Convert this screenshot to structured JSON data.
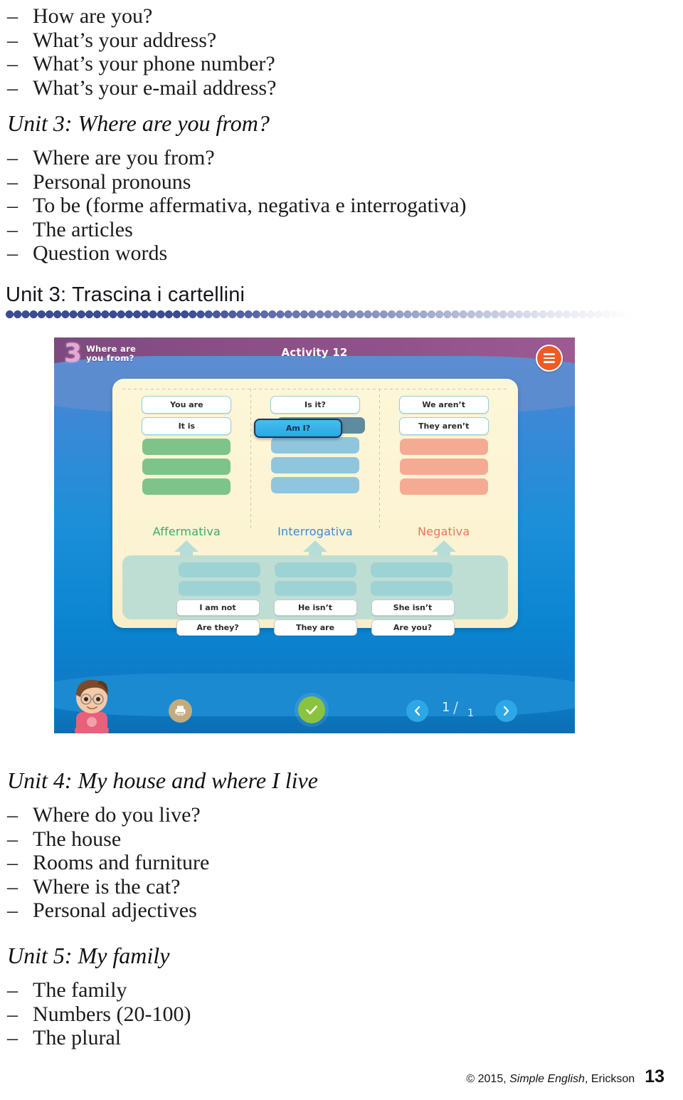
{
  "outline_top": {
    "items": [
      "How are you?",
      "What’s your address?",
      "What’s your phone number?",
      "What’s your e-mail address?"
    ]
  },
  "unit3": {
    "title": "Unit 3: Where are you from?",
    "items": [
      "Where are you from?",
      "Personal pronouns",
      "To be (forme affermativa, negativa e interrogativa)",
      "The articles",
      "Question words"
    ]
  },
  "section": {
    "heading": "Unit 3: Trascina i cartellini"
  },
  "app": {
    "unit_number": "3",
    "unit_subtitle_line1": "Where are",
    "unit_subtitle_line2": "you from?",
    "activity_title": "Activity 12",
    "menu_icon": "hamburger-menu-icon",
    "columns": [
      {
        "category": "Affermativa",
        "category_color": "#3bab6e",
        "slot_color": "#7ec48a",
        "tiles": [
          "You are",
          "It is"
        ],
        "empty_slots": 3
      },
      {
        "category": "Interrogativa",
        "category_color": "#3f8ad2",
        "slot_color": "#8fc6de",
        "tiles": [
          "Is it?"
        ],
        "dragging_tile": "Am I?",
        "empty_slots": 3
      },
      {
        "category": "Negativa",
        "category_color": "#f0725d",
        "slot_color": "#f5ab93",
        "tiles": [
          "We aren’t",
          "They aren’t"
        ],
        "empty_slots": 3
      }
    ],
    "tray": {
      "empty_slot_rows": 2,
      "empty_slots_per_row": 3,
      "word_rows": [
        [
          "I am not",
          "He isn’t",
          "She isn’t"
        ],
        [
          "Are they?",
          "They are",
          "Are you?"
        ]
      ]
    },
    "toolbar": {
      "print_icon": "printer-icon",
      "check_icon": "check-icon",
      "prev_icon": "chevron-left-icon",
      "next_icon": "chevron-right-icon",
      "current_page": "1",
      "separator": "/",
      "total_pages": "1"
    },
    "character": "student-boy-avatar"
  },
  "unit4": {
    "title": "Unit 4: My house and where I live",
    "items": [
      "Where do you live?",
      "The house",
      "Rooms and furniture",
      "Where is the cat?",
      "Personal adjectives"
    ]
  },
  "unit5": {
    "title": "Unit 5: My family",
    "items": [
      "The family",
      "Numbers (20-100)",
      "The plural"
    ]
  },
  "footer": {
    "copyright_prefix": "© 2015, ",
    "copyright_italic": "Simple English",
    "copyright_suffix": ", Erickson",
    "page_number": "13"
  }
}
